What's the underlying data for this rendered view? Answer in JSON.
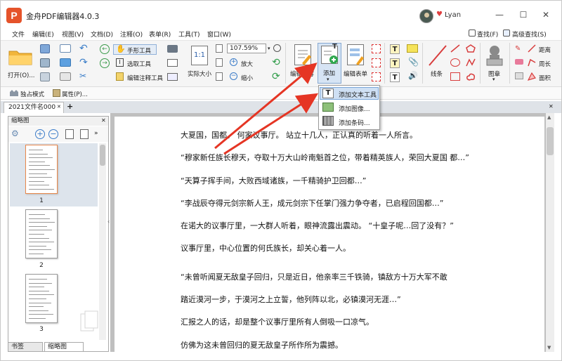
{
  "app": {
    "logo_letter": "P",
    "title": "金舟PDF编辑器4.0.3",
    "user": "Lyan",
    "heart": "♥",
    "minimize": "—",
    "maximize": "☐",
    "close": "✕"
  },
  "menu": [
    "文件",
    "编辑(E)",
    "视图(V)",
    "文档(D)",
    "注释(O)",
    "表单(R)",
    "工具(T)",
    "窗口(W)"
  ],
  "menu_right": {
    "find": "查找(F)",
    "adv_find": "高级查找(S)"
  },
  "ribbon": {
    "open": "打开(O)...",
    "hand_tool": "手形工具",
    "select_tool": "选取工具",
    "edit_annot": "编辑注释工具",
    "actual_size": "实际大小",
    "zoom_value": "107.59%",
    "zoom_in": "放大",
    "zoom_out": "缩小",
    "edit_content": "编辑内容",
    "add": "添加",
    "edit_form": "编辑表单",
    "line": "线条",
    "stamp": "图章",
    "distance": "距离",
    "perimeter": "周长",
    "area": "面积"
  },
  "bar2": {
    "solo_mode": "独占模式",
    "properties": "属性(P)..."
  },
  "tab": {
    "name": "2021文件名000",
    "close": "✕",
    "new": "+",
    "right_close": "✕"
  },
  "panel": {
    "title": "缩略图",
    "close": "✕",
    "pages": [
      "1",
      "2",
      "3"
    ],
    "tab_bookmark": "书签",
    "tab_thumbnail": "缩略图"
  },
  "dropdown": {
    "items": [
      "添加文本工具",
      "添加图像...",
      "添加条码..."
    ]
  },
  "doc_lines": [
    "大夏国，国都。             何家议事厅。      站立十几人，正认真的听着一人所言。",
    "“穆家新任族长穆天，夺取十万大山岭南魁首之位，带着精英族人，荣回大夏国       都…”",
    "“天算子挥手间，大败西域诸族，一千精骑护卫回都…”",
    "“李战辰夺得元剑宗新人王，成元剑宗下任掌门强力争夺者，已启程回国都…”",
    "在诺大的议事厅里，一大群人听着，眼神流露出震动。          “十皇子呢…回了没有？”",
    "议事厅里，中心位置的何氏族长，却关心着一人。",
    "“未曾听闻夏无敌皇子回归，只是近日，他亲率三千铁骑，镇敌方十万大军不敢",
    "踏近漠河一步，于漠河之上立誓，他列阵以北，必镇漠河无涯…”",
    "汇报之人的话，却是整个议事厅里所有人倒吸一口凉气。",
    "仿佛为这未曾回归的夏无敌皇子所作所为震撼。"
  ],
  "colors": {
    "accent": "#e03a2a",
    "logo": "#e5532a",
    "arrow": "#e53524"
  }
}
